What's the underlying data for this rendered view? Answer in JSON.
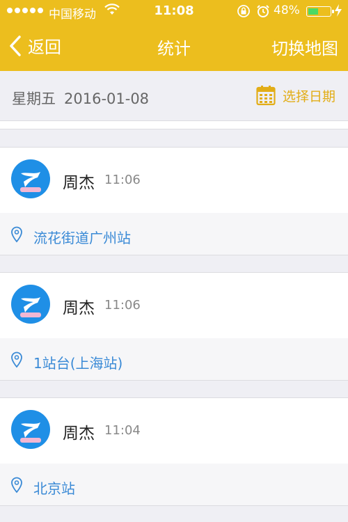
{
  "status_bar": {
    "carrier": "中国移动",
    "time": "11:08",
    "battery": "48%",
    "battery_level": 0.48
  },
  "nav": {
    "back_label": "返回",
    "title": "统计",
    "right_label": "切换地图"
  },
  "date_bar": {
    "weekday": "星期五",
    "date": "2016-01-08",
    "picker_label": "选择日期"
  },
  "records": [
    {
      "name": "周杰",
      "time": "11:06",
      "location": "流花街道广州站"
    },
    {
      "name": "周杰",
      "time": "11:06",
      "location": "1站台(上海站)"
    },
    {
      "name": "周杰",
      "time": "11:04",
      "location": "北京站"
    }
  ],
  "colors": {
    "header": "#ecbe1e",
    "accent": "#e2ad17",
    "link": "#3a8ad6",
    "avatar": "#1f8fe6"
  }
}
